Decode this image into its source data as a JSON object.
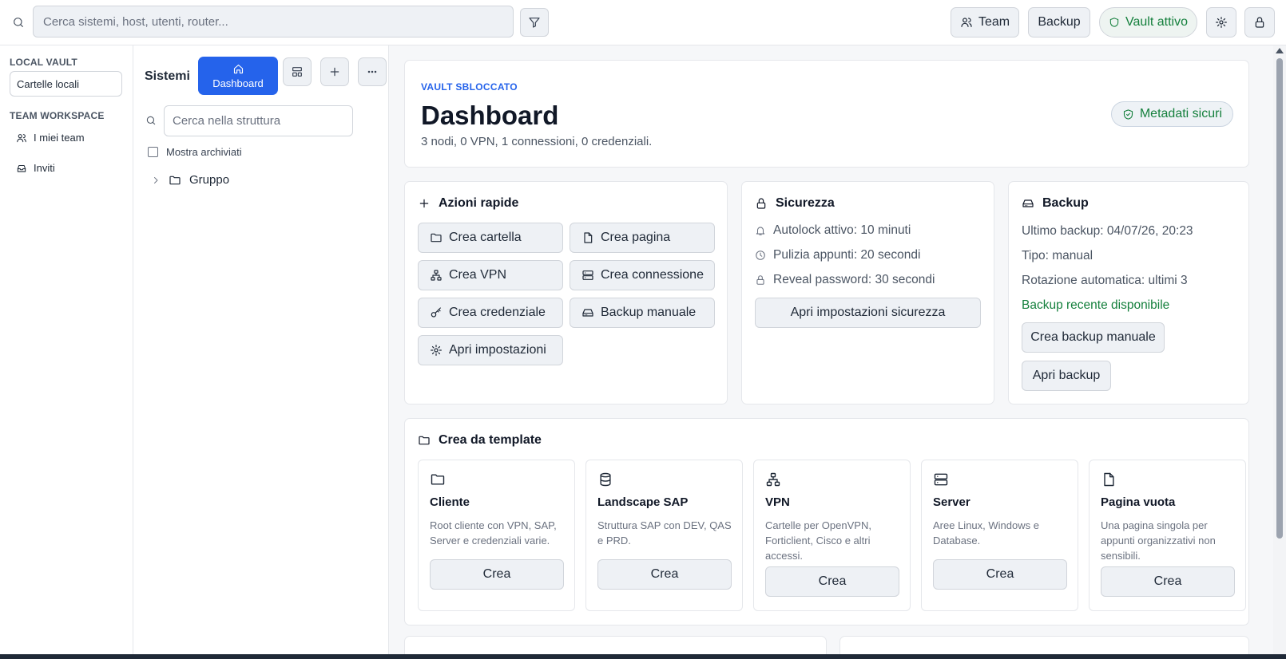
{
  "topbar": {
    "search_placeholder": "Cerca sistemi, host, utenti, router...",
    "team_label": "Team",
    "backup_label": "Backup",
    "vault_label": "Vault attivo"
  },
  "sidebar": {
    "local_vault_title": "LOCAL VAULT",
    "local_folders": "Cartelle locali",
    "team_workspace_title": "TEAM WORKSPACE",
    "my_teams": "I miei team",
    "invites": "Inviti"
  },
  "tree": {
    "title": "Sistemi",
    "dashboard_label": "Dashboard",
    "search_placeholder": "Cerca nella struttura",
    "show_archived": "Mostra archiviati",
    "group_label": "Gruppo"
  },
  "hero": {
    "kicker": "VAULT SBLOCCATO",
    "title": "Dashboard",
    "subtitle": "3 nodi, 0 VPN, 1 connessioni, 0 credenziali.",
    "badge": "Metadati sicuri"
  },
  "quick_actions": {
    "title": "Azioni rapide",
    "create_folder": "Crea cartella",
    "create_page": "Crea pagina",
    "create_vpn": "Crea VPN",
    "create_connection": "Crea connessione",
    "create_credential": "Crea credenziale",
    "manual_backup": "Backup manuale",
    "open_settings": "Apri impostazioni"
  },
  "security": {
    "title": "Sicurezza",
    "autolock": "Autolock attivo: 10 minuti",
    "clipboard": "Pulizia appunti: 20 secondi",
    "reveal": "Reveal password: 30 secondi",
    "open_button": "Apri impostazioni sicurezza"
  },
  "backup": {
    "title": "Backup",
    "last": "Ultimo backup: 04/07/26, 20:23",
    "type": "Tipo: manual",
    "rotation": "Rotazione automatica: ultimi 3",
    "status": "Backup recente disponibile",
    "create_button": "Crea backup manuale",
    "open_button": "Apri backup"
  },
  "templates": {
    "title": "Crea da template",
    "items": [
      {
        "name": "Cliente",
        "desc": "Root cliente con VPN, SAP, Server e credenziali varie.",
        "button": "Crea",
        "icon": "folder-icon"
      },
      {
        "name": "Landscape SAP",
        "desc": "Struttura SAP con DEV, QAS e PRD.",
        "button": "Crea",
        "icon": "database-icon"
      },
      {
        "name": "VPN",
        "desc": "Cartelle per OpenVPN, Forticlient, Cisco e altri accessi.",
        "button": "Crea",
        "icon": "network-icon"
      },
      {
        "name": "Server",
        "desc": "Aree Linux, Windows e Database.",
        "button": "Crea",
        "icon": "server-icon"
      },
      {
        "name": "Pagina vuota",
        "desc": "Una pagina singola per appunti organizzativi non sensibili.",
        "button": "Crea",
        "icon": "file-icon"
      }
    ]
  },
  "colors": {
    "accent": "#2563eb",
    "success": "#15803d",
    "button_bg": "#eef1f5",
    "main_bg": "#f6f7f9"
  }
}
